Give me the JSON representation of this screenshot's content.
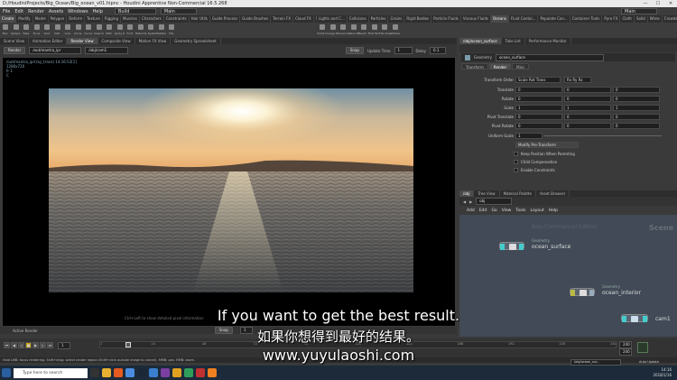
{
  "window": {
    "title": "D:/HoudiniProjects/Big_Ocean/Big_ocean_v01.hipnc - Houdini Apprentice Non-Commercial 16.5.268",
    "controls": [
      "—",
      "☐",
      "✕"
    ]
  },
  "menubar": {
    "items": [
      "File",
      "Edit",
      "Render",
      "Assets",
      "Windows",
      "Help"
    ],
    "desktop": "Build",
    "context": "Main"
  },
  "shelf_tabs_left": [
    "Create",
    "Modify",
    "Model",
    "Polygon",
    "Deform",
    "Texture",
    "Rigging",
    "Muscles",
    "Characters",
    "Constraints",
    "Hair Utils",
    "Guide Process",
    "Guide Brushes",
    "Terrain FX",
    "Cloud FX",
    "Volume"
  ],
  "shelf_tabs_right": [
    "Lights and C...",
    "Collisions",
    "Particles",
    "Grains",
    "Rigid Bodies",
    "Particle Fluids",
    "Viscous Fluids",
    "Oceans",
    "Fluid Contai...",
    "Populate Con...",
    "Container Tools",
    "Pyro FX",
    "Cloth",
    "Solid",
    "Wires",
    "Crowds",
    "Drive Simula..."
  ],
  "shelf_tools_left": [
    "Box",
    "Sphere",
    "Tube",
    "Torus",
    "Grid",
    "Null",
    "Line",
    "Circle",
    "Curve",
    "Draw Curve",
    "Path",
    "Spray Paint",
    "Font",
    "Platonic Solids",
    "L-System",
    "Metaball",
    "File"
  ],
  "shelf_tools_right": [
    "Small Ocean",
    "Large Ocean",
    "Ocean Surface",
    "Wave Tank",
    "Beach Tank",
    "Flat Tank",
    "Flat Sloped",
    "Whitewater"
  ],
  "pane_tabs": [
    "Scene View",
    "Animation Editor",
    "Render View",
    "Composite View",
    "Motion FX View",
    "Geometry Spreadsheet"
  ],
  "viewport_toolbar": {
    "render_button": "Render",
    "renderer": "/out/mantra_ipr",
    "camera": "/obj/cam1",
    "snap_label": "Snap",
    "update_time_label": "Update Time",
    "update_time_value": "1",
    "delay_label": "Delay",
    "delay_value": "0.1"
  },
  "viewport": {
    "info_lines": [
      "/out/mantra_ipr(ray_trace) 14:16:52[1]",
      "1280x720",
      "fr 1",
      "C"
    ],
    "hint": "Ctrl+Left to show detailed pixel information"
  },
  "subtitles": {
    "english": "If you want to get the best result.",
    "chinese": "如果你想得到最好的结果。",
    "url": "www.yuyulaoshi.com"
  },
  "viewport_status": {
    "active_render": "Active Render",
    "snap": "Snap",
    "snap_value": "1"
  },
  "timeline": {
    "start_frame": "1",
    "current_frame": "1",
    "end_frame": "240",
    "end_frame2": "240",
    "ticks": [
      "1",
      "24",
      "48",
      "72",
      "96",
      "120",
      "144",
      "168",
      "192",
      "216",
      "240"
    ]
  },
  "helpbar": "Hold LMB: focus rendering. Shift+drag: select render region (Shift+click outside image to cancel). MMB: pan. RMB: zoom.",
  "taskbar": {
    "search_placeholder": "Type here to search",
    "right_path": "/obj/ocean_sur...",
    "right_mode": "Auto Update",
    "clock": "14:16",
    "date": "2018/1/16"
  },
  "param_pane": {
    "tabs": [
      "/obj/ocean_surface",
      "Take List",
      "Performance Monitor"
    ],
    "node_type": "Geometry",
    "node_name": "ocean_surface",
    "subtabs": [
      "Transform",
      "Render",
      "Misc"
    ],
    "transform_order_label": "Transform Order",
    "transform_order_value": "Scale Rot Trans",
    "rotate_order_value": "Rx Ry Rz",
    "rows": [
      {
        "label": "Translate",
        "values": [
          "0",
          "0",
          "0"
        ]
      },
      {
        "label": "Rotate",
        "values": [
          "0",
          "0",
          "0"
        ]
      },
      {
        "label": "Scale",
        "values": [
          "1",
          "1",
          "1"
        ]
      },
      {
        "label": "Pivot Translate",
        "values": [
          "0",
          "0",
          "0"
        ]
      },
      {
        "label": "Pivot Rotate",
        "values": [
          "0",
          "0",
          "0"
        ]
      },
      {
        "label": "Uniform Scale",
        "values": [
          "1"
        ]
      }
    ],
    "modify_menu": "Modify Pre-Transform",
    "checkboxes": [
      "Keep Position When Parenting",
      "Child Compensation",
      "Enable Constraints"
    ]
  },
  "net_pane": {
    "tabs": [
      "/obj",
      "Tree View",
      "Material Palette",
      "Asset Browser"
    ],
    "path": "obj",
    "menu": [
      "Add",
      "Edit",
      "Go",
      "View",
      "Tools",
      "Layout",
      "Help"
    ],
    "watermark": "Non-Commercial Edition",
    "context_label": "Scene",
    "nodes": [
      {
        "type": "Geometry",
        "name": "ocean_surface"
      },
      {
        "type": "Geometry",
        "name": "ocean_interior"
      },
      {
        "type": "",
        "name": "cam1"
      }
    ]
  }
}
